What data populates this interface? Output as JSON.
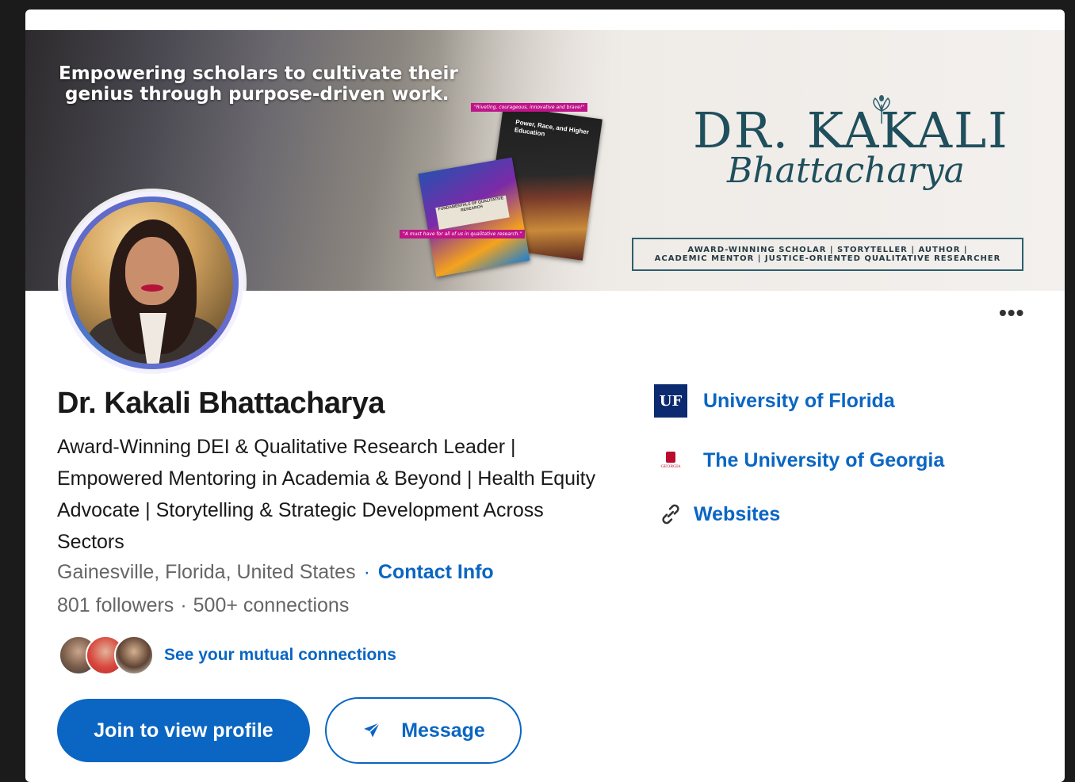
{
  "banner": {
    "tagline_line1": "Empowering scholars to cultivate their",
    "tagline_line2": "genius through purpose-driven work.",
    "book_quote_top": "\"Riveting, courageous, innovative and brave!\"",
    "book_quote_bottom": "\"A must have for all of us in qualitative research.\"",
    "book2_title": "Power, Race, and Higher Education",
    "book1_title": "FUNDAMENTALS OF QUALITATIVE RESEARCH",
    "logo_name": "DR. KAKALI",
    "logo_script": "Bhattacharya",
    "box_line1": "AWARD-WINNING SCHOLAR | STORYTELLER | AUTHOR |",
    "box_line2": "ACADEMIC MENTOR | JUSTICE-ORIENTED QUALITATIVE RESEARCHER"
  },
  "profile": {
    "name": "Dr. Kakali Bhattacharya",
    "headline": "Award-Winning DEI & Qualitative Research Leader | Empowered Mentoring in Academia & Beyond | Health Equity Advocate | Storytelling & Strategic Development Across Sectors",
    "location": "Gainesville, Florida, United States",
    "contact_link": "Contact Info",
    "followers": "801 followers",
    "connections": "500+ connections",
    "mutual_link": "See your mutual connections",
    "more_label": "•••"
  },
  "actions": {
    "join_label": "Join to view profile",
    "message_label": "Message"
  },
  "sidebar": {
    "items": [
      {
        "label": "University of Florida",
        "icon": "uf-logo",
        "logo_text": "UF"
      },
      {
        "label": "The University of Georgia",
        "icon": "uga-logo",
        "logo_text": "GEORGIA"
      },
      {
        "label": "Websites",
        "icon": "link-icon"
      }
    ]
  },
  "colors": {
    "accent": "#0a66c2",
    "text": "#191919",
    "muted": "#666666"
  }
}
